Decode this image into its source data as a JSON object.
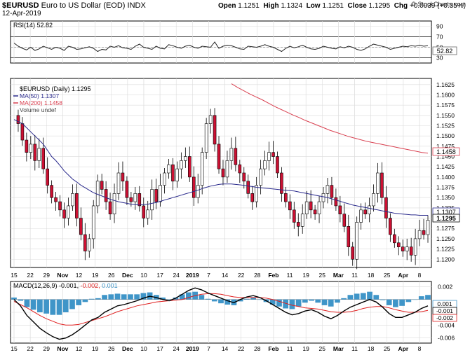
{
  "header": {
    "symbol": "$EURUSD",
    "description": "Euro to US Dollar (EOD)",
    "exchange": "INDX",
    "date": "12-Apr-2019",
    "brand": "© StockCharts.com",
    "open_label": "Open",
    "open": "1.1251",
    "high_label": "High",
    "high": "1.1324",
    "low_label": "Low",
    "low": "1.1251",
    "close_label": "Close",
    "close": "1.1295",
    "chg_label": "Chg",
    "chg": "+0.0039 (+0.35%)"
  },
  "panels": {
    "rsi": {
      "label": "RSI(14) 52.82",
      "value_badge": "52.82"
    },
    "price": {
      "label": "$EURUSD (Daily) 1.1295",
      "ma50_label": "MA(50) 1.1307",
      "ma200_label": "MA(200) 1.1458",
      "volume_label": "Volume undef",
      "badge_ma200": "1.1458",
      "badge_ma50": "1.1307",
      "badge_close": "1.1295"
    },
    "macd": {
      "label_prefix": "MACD(12,26,9)",
      "macd_value": "-0.001,",
      "signal_value": "-0.002,",
      "hist_value": "0.001",
      "badge_hist": "0.001",
      "badge_macd": "-0.001",
      "badge_signal": "-0.002"
    }
  },
  "colors": {
    "up": "#ffffff",
    "down": "#cc1133",
    "candle_outline": "#000000",
    "ma50": "#2a2a8c",
    "ma200": "#d94050",
    "macd": "#000000",
    "signal": "#e02020",
    "hist": "#3f95c8",
    "grid": "#dcdcdc"
  },
  "chart_data": [
    {
      "type": "line",
      "title": "RSI(14) 52.82",
      "series": [
        {
          "name": "RSI(14)",
          "values": [
            58,
            52,
            48,
            45,
            50,
            44,
            47,
            52,
            49,
            46,
            50,
            48,
            44,
            52,
            50,
            46,
            47,
            49,
            51,
            48,
            42,
            46,
            45,
            52,
            50,
            53,
            49,
            48,
            46,
            52,
            56,
            50,
            48,
            46,
            52,
            48,
            47,
            55,
            53,
            50,
            48,
            52,
            54,
            50,
            48,
            52,
            51,
            50,
            60,
            48,
            52,
            54,
            53,
            50,
            47,
            46,
            52,
            51,
            50,
            52,
            55,
            52,
            50,
            46,
            42,
            48,
            52,
            49,
            51,
            54,
            50,
            47,
            46,
            48,
            52,
            50,
            48,
            47,
            51,
            49,
            52,
            50,
            46,
            44,
            47,
            52,
            56,
            54,
            52,
            50,
            46,
            48,
            50,
            52,
            51,
            53,
            52,
            54,
            52,
            53
          ]
        }
      ],
      "yticks": [
        30,
        50,
        70,
        90
      ],
      "ylim": [
        20,
        100
      ],
      "reference_lines": [
        30,
        70
      ]
    },
    {
      "type": "line",
      "title": "$EURUSD (Daily) 1.1295",
      "x_tick_labels": [
        "15",
        "22",
        "29",
        "Nov",
        "12",
        "19",
        "26",
        "Dec",
        "10",
        "17",
        "24",
        "2019",
        "7",
        "14",
        "22",
        "28",
        "Feb",
        "11",
        "19",
        "25",
        "Mar",
        "11",
        "18",
        "25",
        "Apr",
        "8"
      ],
      "series": [
        {
          "name": "$EURUSD",
          "values": [
            1.155,
            1.153,
            1.149,
            1.146,
            1.148,
            1.144,
            1.147,
            1.142,
            1.138,
            1.135,
            1.134,
            1.132,
            1.13,
            1.133,
            1.136,
            1.13,
            1.126,
            1.122,
            1.125,
            1.133,
            1.139,
            1.137,
            1.134,
            1.131,
            1.136,
            1.141,
            1.139,
            1.135,
            1.134,
            1.136,
            1.133,
            1.13,
            1.132,
            1.137,
            1.134,
            1.138,
            1.141,
            1.143,
            1.139,
            1.142,
            1.144,
            1.145,
            1.14,
            1.135,
            1.138,
            1.146,
            1.153,
            1.155,
            1.148,
            1.142,
            1.14,
            1.144,
            1.147,
            1.143,
            1.141,
            1.139,
            1.136,
            1.134,
            1.138,
            1.142,
            1.144,
            1.146,
            1.145,
            1.141,
            1.136,
            1.134,
            1.132,
            1.129,
            1.128,
            1.131,
            1.134,
            1.132,
            1.131,
            1.134,
            1.136,
            1.138,
            1.135,
            1.133,
            1.131,
            1.128,
            1.123,
            1.12,
            1.129,
            1.132,
            1.131,
            1.133,
            1.136,
            1.141,
            1.135,
            1.13,
            1.126,
            1.124,
            1.123,
            1.122,
            1.123,
            1.121,
            1.125,
            1.127,
            1.126,
            1.1295
          ]
        },
        {
          "name": "MA(50)",
          "values": [
            1.154,
            1.1535,
            1.153,
            1.152,
            1.151,
            1.15,
            1.149,
            1.148,
            1.1465,
            1.145,
            1.144,
            1.1428,
            1.1415,
            1.1405,
            1.1395,
            1.1388,
            1.138,
            1.1374,
            1.1368,
            1.1362,
            1.1358,
            1.1354,
            1.135,
            1.1346,
            1.1343,
            1.134,
            1.1338,
            1.1336,
            1.1334,
            1.1333,
            1.1332,
            1.1333,
            1.1334,
            1.1336,
            1.1338,
            1.1341,
            1.1344,
            1.1347,
            1.135,
            1.1353,
            1.1356,
            1.1359,
            1.1362,
            1.1365,
            1.1368,
            1.1372,
            1.1375,
            1.1378,
            1.138,
            1.1382,
            1.1383,
            1.1383,
            1.1383,
            1.1382,
            1.1381,
            1.138,
            1.1378,
            1.1377,
            1.1375,
            1.1374,
            1.1373,
            1.1372,
            1.1371,
            1.137,
            1.1369,
            1.1368,
            1.1367,
            1.1366,
            1.1364,
            1.1362,
            1.136,
            1.1358,
            1.1356,
            1.1354,
            1.1352,
            1.135,
            1.1347,
            1.1344,
            1.1341,
            1.1338,
            1.1335,
            1.1332,
            1.133,
            1.1328,
            1.1326,
            1.1324,
            1.1322,
            1.132,
            1.1318,
            1.1316,
            1.1314,
            1.1312,
            1.1311,
            1.131,
            1.1309,
            1.1308,
            1.1308,
            1.1307,
            1.1307,
            1.1307
          ]
        },
        {
          "name": "MA(200)",
          "values": [
            1.1627,
            1.1618,
            1.161,
            1.1602,
            1.1595,
            1.1588,
            1.158,
            1.1572,
            1.1565,
            1.1558,
            1.1551,
            1.1545,
            1.1538,
            1.1532,
            1.1526,
            1.152,
            1.1514,
            1.1509,
            1.1504,
            1.1499,
            1.1495,
            1.1491,
            1.1487,
            1.1484,
            1.1481,
            1.1478,
            1.1475,
            1.1472,
            1.1469,
            1.1466,
            1.1463,
            1.146,
            1.1458
          ]
        }
      ],
      "yticks": [
        1.12,
        1.1225,
        1.125,
        1.1275,
        1.13,
        1.1325,
        1.135,
        1.1375,
        1.14,
        1.1425,
        1.145,
        1.1475,
        1.15,
        1.1525,
        1.155,
        1.1575,
        1.16,
        1.1625
      ],
      "ylim": [
        1.118,
        1.164
      ]
    },
    {
      "type": "line",
      "title": "MACD(12,26,9)",
      "series": [
        {
          "name": "MACD",
          "values": [
            0.0,
            -0.001,
            -0.0025,
            -0.0035,
            -0.0045,
            -0.0052,
            -0.0058,
            -0.0062,
            -0.006,
            -0.0055,
            -0.0048,
            -0.004,
            -0.0032,
            -0.0028,
            -0.002,
            -0.0015,
            -0.001,
            -0.0008,
            -0.0005,
            -0.0002,
            0.0002,
            0.0005,
            0.0003,
            0.0,
            -0.0002,
            0.0002,
            0.0008,
            0.0014,
            0.0018,
            0.0015,
            0.001,
            0.0006,
            0.0002,
            -0.0002,
            -0.0005,
            0.0,
            0.0004,
            0.0006,
            0.0003,
            -0.0002,
            -0.0008,
            -0.0014,
            -0.002,
            -0.0024,
            -0.0022,
            -0.0018,
            -0.0016,
            -0.002,
            -0.0026,
            -0.003,
            -0.0025,
            -0.0018,
            -0.0012,
            -0.0008,
            -0.0004,
            0.0,
            -0.0004,
            -0.0012,
            -0.0022,
            -0.0028,
            -0.0028,
            -0.0024,
            -0.002,
            -0.0014,
            -0.001
          ]
        },
        {
          "name": "Signal",
          "values": [
            -0.0003,
            -0.0008,
            -0.0013,
            -0.0019,
            -0.0025,
            -0.003,
            -0.0034,
            -0.0038,
            -0.004,
            -0.004,
            -0.0039,
            -0.0036,
            -0.0033,
            -0.003,
            -0.0027,
            -0.0023,
            -0.0019,
            -0.0016,
            -0.0013,
            -0.001,
            -0.0008,
            -0.0006,
            -0.0004,
            -0.0003,
            -0.0002,
            -0.0001,
            0.0,
            0.0003,
            0.0006,
            0.0008,
            0.0009,
            0.0009,
            0.0008,
            0.0006,
            0.0004,
            0.0003,
            0.0003,
            0.0003,
            0.0003,
            0.0002,
            0.0,
            -0.0003,
            -0.0006,
            -0.0009,
            -0.0011,
            -0.0013,
            -0.0014,
            -0.0015,
            -0.0017,
            -0.0019,
            -0.002,
            -0.002,
            -0.0019,
            -0.0017,
            -0.0014,
            -0.0012,
            -0.0011,
            -0.0011,
            -0.0013,
            -0.0016,
            -0.0018,
            -0.002,
            -0.002,
            -0.0019,
            -0.0017
          ]
        },
        {
          "name": "Histogram",
          "values": [
            0.0003,
            -0.0002,
            -0.0012,
            -0.0016,
            -0.002,
            -0.0022,
            -0.0024,
            -0.0024,
            -0.002,
            -0.0015,
            -0.0009,
            -0.0004,
            0.0001,
            0.0002,
            0.0007,
            0.0008,
            0.0009,
            0.0008,
            0.0008,
            0.0008,
            0.001,
            0.0011,
            0.0007,
            0.0003,
            0.0,
            0.0003,
            0.0008,
            0.0011,
            0.0012,
            0.0007,
            0.0001,
            -0.0003,
            -0.0006,
            -0.0008,
            -0.0009,
            -0.0003,
            0.0001,
            0.0003,
            0.0,
            -0.0004,
            -0.0008,
            -0.0011,
            -0.0014,
            -0.0015,
            -0.0011,
            -0.0005,
            -0.0002,
            -0.0005,
            -0.0009,
            -0.0011,
            -0.0005,
            0.0002,
            0.0007,
            0.0009,
            0.001,
            0.0012,
            0.0007,
            -0.0001,
            -0.0009,
            -0.0012,
            -0.001,
            -0.0004,
            0.0,
            0.0005,
            0.0007
          ]
        }
      ],
      "yticks": [
        -0.006,
        -0.004,
        -0.002,
        0.002
      ],
      "ylim": [
        -0.0068,
        0.0028
      ]
    }
  ]
}
